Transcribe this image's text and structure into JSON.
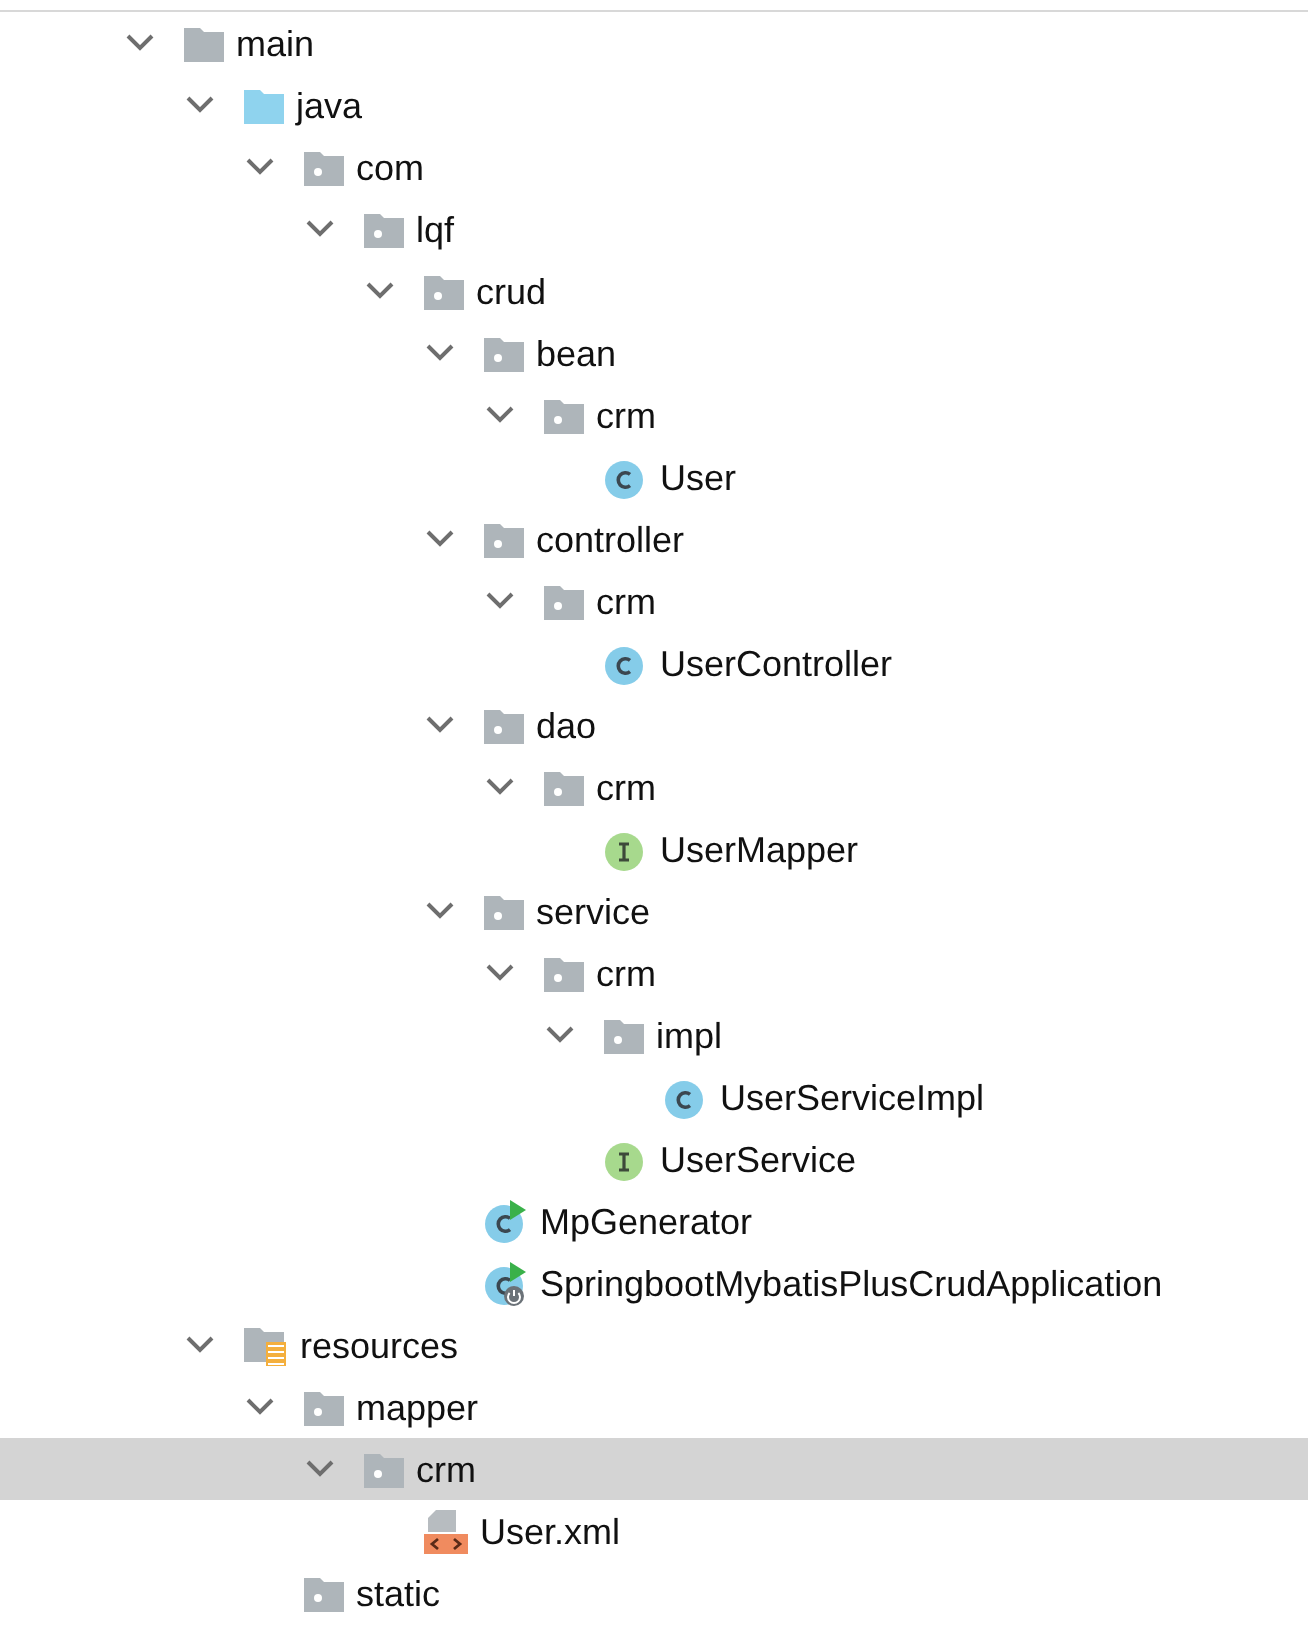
{
  "tree": [
    {
      "label": "main",
      "kind": "folder",
      "expanded": true,
      "selected": false,
      "children": [
        {
          "label": "java",
          "kind": "source-folder",
          "expanded": true,
          "selected": false,
          "children": [
            {
              "label": "com",
              "kind": "package",
              "expanded": true,
              "selected": false,
              "children": [
                {
                  "label": "lqf",
                  "kind": "package",
                  "expanded": true,
                  "selected": false,
                  "children": [
                    {
                      "label": "crud",
                      "kind": "package",
                      "expanded": true,
                      "selected": false,
                      "children": [
                        {
                          "label": "bean",
                          "kind": "package",
                          "expanded": true,
                          "selected": false,
                          "children": [
                            {
                              "label": "crm",
                              "kind": "package",
                              "expanded": true,
                              "selected": false,
                              "children": [
                                {
                                  "label": "User",
                                  "kind": "class",
                                  "selected": false
                                }
                              ]
                            }
                          ]
                        },
                        {
                          "label": "controller",
                          "kind": "package",
                          "expanded": true,
                          "selected": false,
                          "children": [
                            {
                              "label": "crm",
                              "kind": "package",
                              "expanded": true,
                              "selected": false,
                              "children": [
                                {
                                  "label": "UserController",
                                  "kind": "class",
                                  "selected": false
                                }
                              ]
                            }
                          ]
                        },
                        {
                          "label": "dao",
                          "kind": "package",
                          "expanded": true,
                          "selected": false,
                          "children": [
                            {
                              "label": "crm",
                              "kind": "package",
                              "expanded": true,
                              "selected": false,
                              "children": [
                                {
                                  "label": "UserMapper",
                                  "kind": "interface",
                                  "selected": false
                                }
                              ]
                            }
                          ]
                        },
                        {
                          "label": "service",
                          "kind": "package",
                          "expanded": true,
                          "selected": false,
                          "children": [
                            {
                              "label": "crm",
                              "kind": "package",
                              "expanded": true,
                              "selected": false,
                              "children": [
                                {
                                  "label": "impl",
                                  "kind": "package",
                                  "expanded": true,
                                  "selected": false,
                                  "children": [
                                    {
                                      "label": "UserServiceImpl",
                                      "kind": "class",
                                      "selected": false
                                    }
                                  ]
                                },
                                {
                                  "label": "UserService",
                                  "kind": "interface",
                                  "selected": false
                                }
                              ]
                            }
                          ]
                        },
                        {
                          "label": "MpGenerator",
                          "kind": "runnable-class",
                          "selected": false
                        },
                        {
                          "label": "SpringbootMybatisPlusCrudApplication",
                          "kind": "spring-app",
                          "selected": false
                        }
                      ]
                    }
                  ]
                }
              ]
            }
          ]
        },
        {
          "label": "resources",
          "kind": "resources-folder",
          "expanded": true,
          "selected": false,
          "children": [
            {
              "label": "mapper",
              "kind": "package",
              "expanded": true,
              "selected": false,
              "children": [
                {
                  "label": "crm",
                  "kind": "package",
                  "expanded": true,
                  "selected": true,
                  "children": [
                    {
                      "label": "User.xml",
                      "kind": "xml",
                      "selected": false
                    }
                  ]
                }
              ]
            },
            {
              "label": "static",
              "kind": "package",
              "selected": false
            }
          ]
        }
      ]
    }
  ]
}
